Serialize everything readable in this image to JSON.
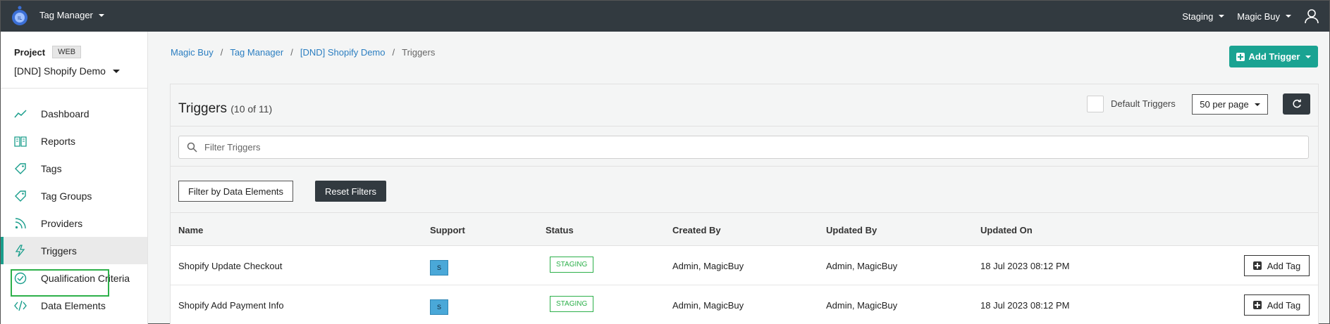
{
  "topbar": {
    "app_name": "Tag Manager",
    "env": "Staging",
    "account": "Magic Buy",
    "colors": {
      "bar": "#323a40",
      "accent": "#1aa392"
    }
  },
  "sidebar": {
    "project_label": "Project",
    "project_type": "WEB",
    "project_name": "[DND] Shopify Demo",
    "items": [
      {
        "label": "Dashboard",
        "icon": "chart-line-icon"
      },
      {
        "label": "Reports",
        "icon": "book-icon"
      },
      {
        "label": "Tags",
        "icon": "tag-icon"
      },
      {
        "label": "Tag Groups",
        "icon": "tag-icon"
      },
      {
        "label": "Providers",
        "icon": "rss-icon"
      },
      {
        "label": "Triggers",
        "icon": "bolt-icon",
        "active": true
      },
      {
        "label": "Qualification Criteria",
        "icon": "check-circle-icon"
      },
      {
        "label": "Data Elements",
        "icon": "code-icon"
      }
    ]
  },
  "breadcrumb": {
    "items": [
      "Magic Buy",
      "Tag Manager",
      "[DND] Shopify Demo"
    ],
    "current": "Triggers"
  },
  "actions": {
    "add_trigger": "Add Trigger"
  },
  "panel": {
    "title": "Triggers",
    "count": "(10 of 11)",
    "default_triggers_label": "Default Triggers",
    "per_page": "50 per page",
    "search_placeholder": "Filter Triggers",
    "filter_button": "Filter by Data Elements",
    "reset_button": "Reset Filters"
  },
  "table": {
    "columns": {
      "name": "Name",
      "support": "Support",
      "status": "Status",
      "created_by": "Created By",
      "updated_by": "Updated By",
      "updated_on": "Updated On"
    },
    "rows": [
      {
        "name": "Shopify Update Checkout",
        "support": "S",
        "status": "STAGING",
        "created_by": "Admin, MagicBuy",
        "updated_by": "Admin, MagicBuy",
        "updated_on": "18 Jul 2023 08:12 PM",
        "action": "Add Tag"
      },
      {
        "name": "Shopify Add Payment Info",
        "support": "S",
        "status": "STAGING",
        "created_by": "Admin, MagicBuy",
        "updated_by": "Admin, MagicBuy",
        "updated_on": "18 Jul 2023 08:12 PM",
        "action": "Add Tag"
      }
    ]
  }
}
